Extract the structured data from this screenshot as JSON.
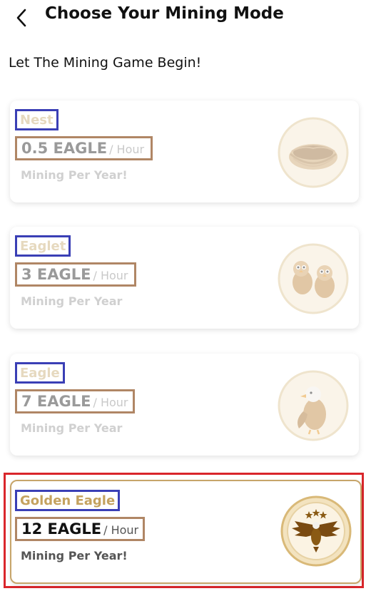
{
  "header": {
    "title": "Choose Your Mining Mode",
    "back_icon": "chevron-left-icon"
  },
  "subtitle": "Let The Mining Game Begin!",
  "colors": {
    "accent_gold": "#c4a25f",
    "name_highlight": "#3a3fb5",
    "rate_highlight": "#b08665",
    "selected_outline": "#d9262b"
  },
  "modes": [
    {
      "name": "Nest",
      "rate": "0.5 EAGLE",
      "unit": "/ Hour",
      "caption": "Mining Per Year!",
      "icon": "nest-icon",
      "selected": false
    },
    {
      "name": "Eaglet",
      "rate": "3 EAGLE",
      "unit": "/ Hour",
      "caption": "Mining Per Year",
      "icon": "eaglet-pair-icon",
      "selected": false
    },
    {
      "name": "Eagle",
      "rate": "7 EAGLE",
      "unit": "/ Hour",
      "caption": "Mining Per Year",
      "icon": "eagle-icon",
      "selected": false
    },
    {
      "name": "Golden Eagle",
      "rate": "12 EAGLE",
      "unit": "/ Hour",
      "caption": "Mining Per Year!",
      "icon": "golden-eagle-emblem-icon",
      "selected": true
    }
  ]
}
